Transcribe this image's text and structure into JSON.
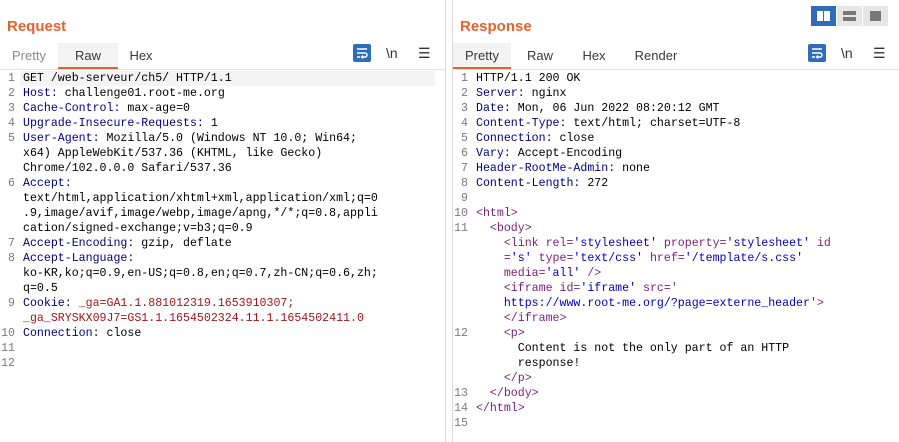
{
  "request": {
    "title": "Request",
    "tabs": [
      {
        "label": "Pretty"
      },
      {
        "label": "Raw"
      },
      {
        "label": "Hex"
      }
    ],
    "active_tab": "Raw",
    "newline_toggle": "\\n",
    "menu": "☰",
    "lines": [
      {
        "n": "1",
        "y": 0,
        "t": "GET /web-serveur/ch5/ HTTP/1.1"
      },
      {
        "n": "2",
        "y": 1,
        "k": "Host:",
        "v": " challenge01.root-me.org"
      },
      {
        "n": "3",
        "y": 2,
        "k": "Cache-Control:",
        "v": " max-age=0"
      },
      {
        "n": "4",
        "y": 3,
        "k": "Upgrade-Insecure-Requests:",
        "v": " 1"
      },
      {
        "n": "5",
        "y": 4,
        "k": "User-Agent:",
        "v": " Mozilla/5.0 (Windows NT 10.0; Win64;"
      },
      {
        "n": "",
        "y": 5,
        "t": "x64) AppleWebKit/537.36 (KHTML, like Gecko)"
      },
      {
        "n": "",
        "y": 6,
        "t": "Chrome/102.0.0.0 Safari/537.36"
      },
      {
        "n": "6",
        "y": 7,
        "k": "Accept:"
      },
      {
        "n": "",
        "y": 8,
        "t": "text/html,application/xhtml+xml,application/xml;q=0"
      },
      {
        "n": "",
        "y": 9,
        "t": ".9,image/avif,image/webp,image/apng,*/*;q=0.8,appli"
      },
      {
        "n": "",
        "y": 10,
        "t": "cation/signed-exchange;v=b3;q=0.9"
      },
      {
        "n": "7",
        "y": 11,
        "k": "Accept-Encoding:",
        "v": " gzip, deflate"
      },
      {
        "n": "8",
        "y": 12,
        "k": "Accept-Language:"
      },
      {
        "n": "",
        "y": 13,
        "t": "ko-KR,ko;q=0.9,en-US;q=0.8,en;q=0.7,zh-CN;q=0.6,zh;"
      },
      {
        "n": "",
        "y": 14,
        "t": "q=0.5"
      },
      {
        "n": "9",
        "y": 15,
        "k": "Cookie:",
        "c": " _ga=GA1.1.881012319.1653910307;"
      },
      {
        "n": "",
        "y": 16,
        "c": "_ga_SRYSKX09J7=GS1.1.1654502324.11.1.1654502411.0"
      },
      {
        "n": "10",
        "y": 17,
        "k": "Connection:",
        "v": " close"
      },
      {
        "n": "11",
        "y": 18,
        "t": ""
      },
      {
        "n": "12",
        "y": 19,
        "t": ""
      }
    ]
  },
  "response": {
    "title": "Response",
    "tabs": [
      {
        "label": "Pretty"
      },
      {
        "label": "Raw"
      },
      {
        "label": "Hex"
      },
      {
        "label": "Render"
      }
    ],
    "active_tab": "Pretty",
    "newline_toggle": "\\n",
    "menu": "☰",
    "lines": [
      {
        "n": "1",
        "y": 0,
        "t": "HTTP/1.1 200 OK"
      },
      {
        "n": "2",
        "y": 1,
        "k": "Server:",
        "v": " nginx"
      },
      {
        "n": "3",
        "y": 2,
        "k": "Date:",
        "v": " Mon, 06 Jun 2022 08:20:12 GMT"
      },
      {
        "n": "4",
        "y": 3,
        "k": "Content-Type:",
        "v": " text/html; charset=UTF-8"
      },
      {
        "n": "5",
        "y": 4,
        "k": "Connection:",
        "v": " close"
      },
      {
        "n": "6",
        "y": 5,
        "k": "Vary:",
        "v": " Accept-Encoding"
      },
      {
        "n": "7",
        "y": 6,
        "k": "Header-RootMe-Admin:",
        "v": " none"
      },
      {
        "n": "8",
        "y": 7,
        "k": "Content-Length:",
        "v": " 272"
      },
      {
        "n": "9",
        "y": 8,
        "t": ""
      },
      {
        "n": "10",
        "y": 9,
        "h": "<html>"
      },
      {
        "n": "11",
        "y": 10,
        "h": "  <body>"
      },
      {
        "n": "",
        "y": 11,
        "h": "    <link rel='stylesheet' property='stylesheet' id"
      },
      {
        "n": "",
        "y": 12,
        "h": "    ='s' type='text/css' href='/template/s.css'"
      },
      {
        "n": "",
        "y": 13,
        "h": "    media='all' />"
      },
      {
        "n": "",
        "y": 14,
        "h": "    <iframe id='iframe' src='"
      },
      {
        "n": "",
        "y": 15,
        "h": "    https://www.root-me.org/?page=externe_header'>"
      },
      {
        "n": "",
        "y": 16,
        "h": "    </iframe>"
      },
      {
        "n": "12",
        "y": 17,
        "h": "    <p>"
      },
      {
        "n": "",
        "y": 18,
        "t": "      Content is not the only part of an HTTP"
      },
      {
        "n": "",
        "y": 19,
        "t": "      response!"
      },
      {
        "n": "",
        "y": 20,
        "h": "    </p>"
      },
      {
        "n": "13",
        "y": 21,
        "h": "  </body>"
      },
      {
        "n": "14",
        "y": 22,
        "h": "</html>"
      },
      {
        "n": "15",
        "y": 23,
        "t": ""
      }
    ]
  },
  "layout_buttons": [
    {
      "icon": "split-horizontal-icon",
      "active": true
    },
    {
      "icon": "split-vertical-icon",
      "active": false
    },
    {
      "icon": "tabs-icon",
      "active": false
    }
  ],
  "colors": {
    "accent": "#e8602c",
    "blue": "#2f6dbb",
    "header_key": "#000080",
    "cookie": "#a01818",
    "html_tag": "#7a1f7a"
  }
}
